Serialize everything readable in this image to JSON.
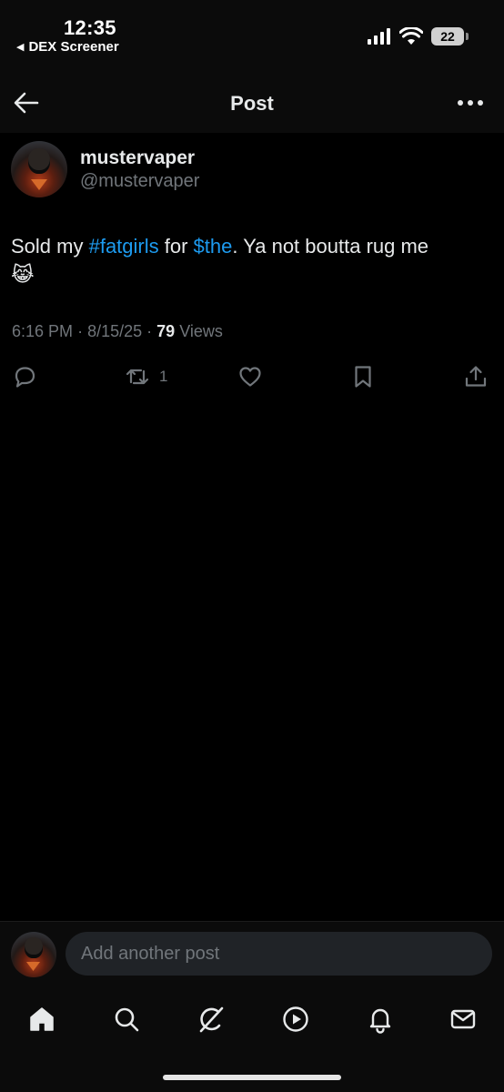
{
  "status_bar": {
    "time": "12:35",
    "back_app": "DEX Screener",
    "battery": "22"
  },
  "header": {
    "title": "Post"
  },
  "post": {
    "display_name": "mustervaper",
    "handle": "@mustervaper",
    "text_parts": {
      "t1": "Sold my ",
      "hashtag": "#fatgirls",
      "t2": " for ",
      "cashtag": "$the",
      "t3": ". Ya not boutta rug me",
      "emoji": "😹"
    },
    "time": "6:16 PM",
    "separator": "·",
    "date": "8/15/25",
    "views_count": "79",
    "views_label": "Views"
  },
  "actions": {
    "repost_count": "1"
  },
  "reply": {
    "placeholder": "Add another post"
  },
  "nav": {
    "items": [
      "home-icon",
      "search-icon",
      "grok-icon",
      "video-icon",
      "notifications-icon",
      "messages-icon"
    ]
  },
  "colors": {
    "background": "#000000",
    "text": "#e7e9ea",
    "muted": "#71767b",
    "link": "#1d9bf0",
    "input_bg": "#202327"
  }
}
